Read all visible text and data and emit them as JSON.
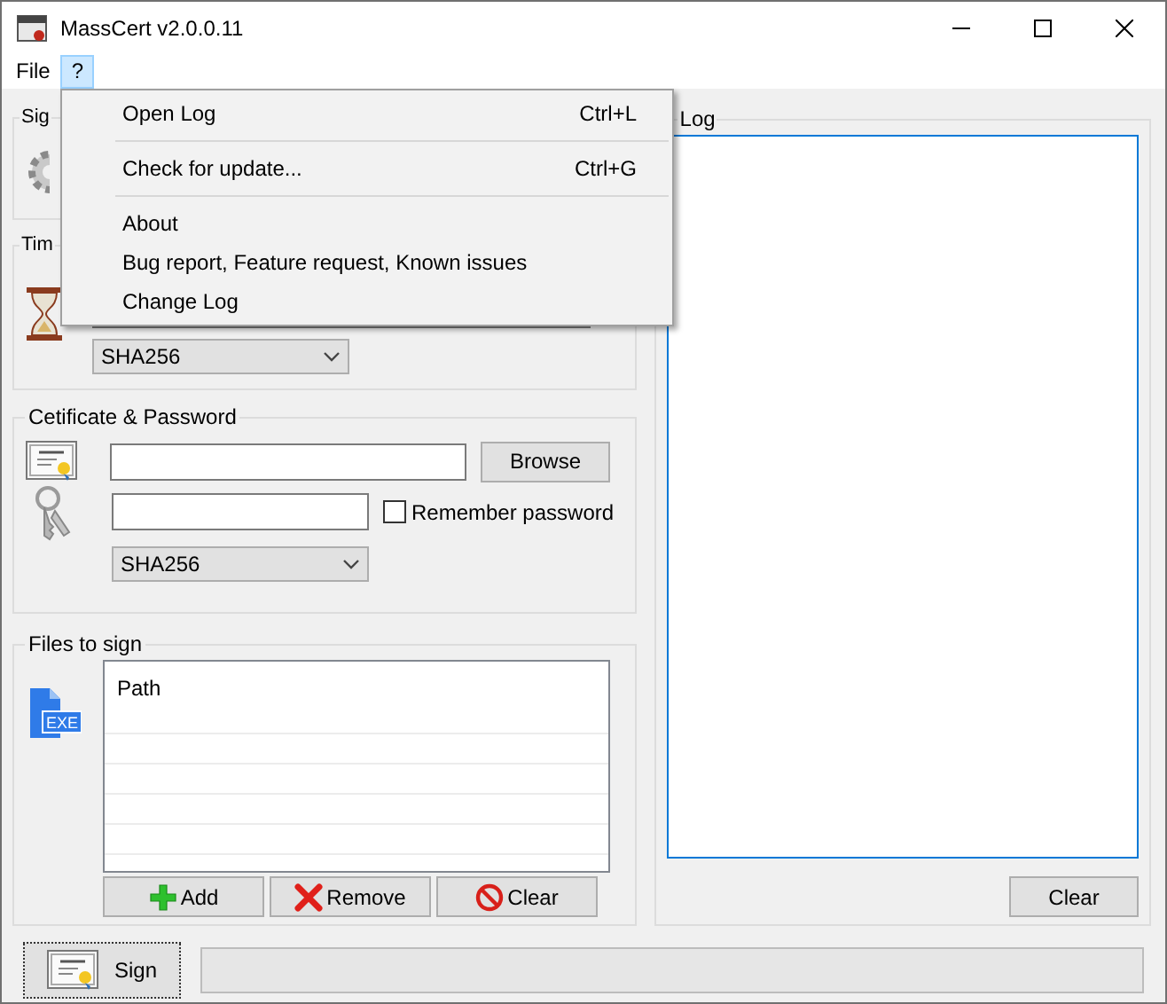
{
  "window": {
    "title": "MassCert v2.0.0.11"
  },
  "menu_bar": [
    {
      "label": "File",
      "selected": false
    },
    {
      "label": "?",
      "selected": true
    }
  ],
  "help_menu": [
    {
      "kind": "item",
      "label": "Open Log",
      "shortcut": "Ctrl+L"
    },
    {
      "kind": "separator"
    },
    {
      "kind": "item",
      "label": "Check for update...",
      "shortcut": "Ctrl+G"
    },
    {
      "kind": "separator"
    },
    {
      "kind": "item",
      "label": "About"
    },
    {
      "kind": "item",
      "label": "Bug report, Feature request, Known issues"
    },
    {
      "kind": "item",
      "label": "Change Log"
    }
  ],
  "signing_group": {
    "title": "Sig"
  },
  "timestamp_group": {
    "title": "Tim",
    "algorithm": "SHA256"
  },
  "certificate_group": {
    "title": "Cetificate & Password",
    "browse_button": "Browse",
    "remember_password": {
      "label": "Remember password",
      "checked": false
    },
    "algorithm": "SHA256"
  },
  "files_group": {
    "title": "Files to sign",
    "file_icon_label": "EXE",
    "list_header": "Path",
    "buttons": [
      {
        "kind": "add",
        "label": "Add"
      },
      {
        "kind": "remove",
        "label": "Remove"
      },
      {
        "kind": "clear",
        "label": "Clear"
      }
    ]
  },
  "log_group": {
    "title": "Log",
    "clear_button": "Clear"
  },
  "sign_button": "Sign",
  "progress": {
    "level": 0
  }
}
